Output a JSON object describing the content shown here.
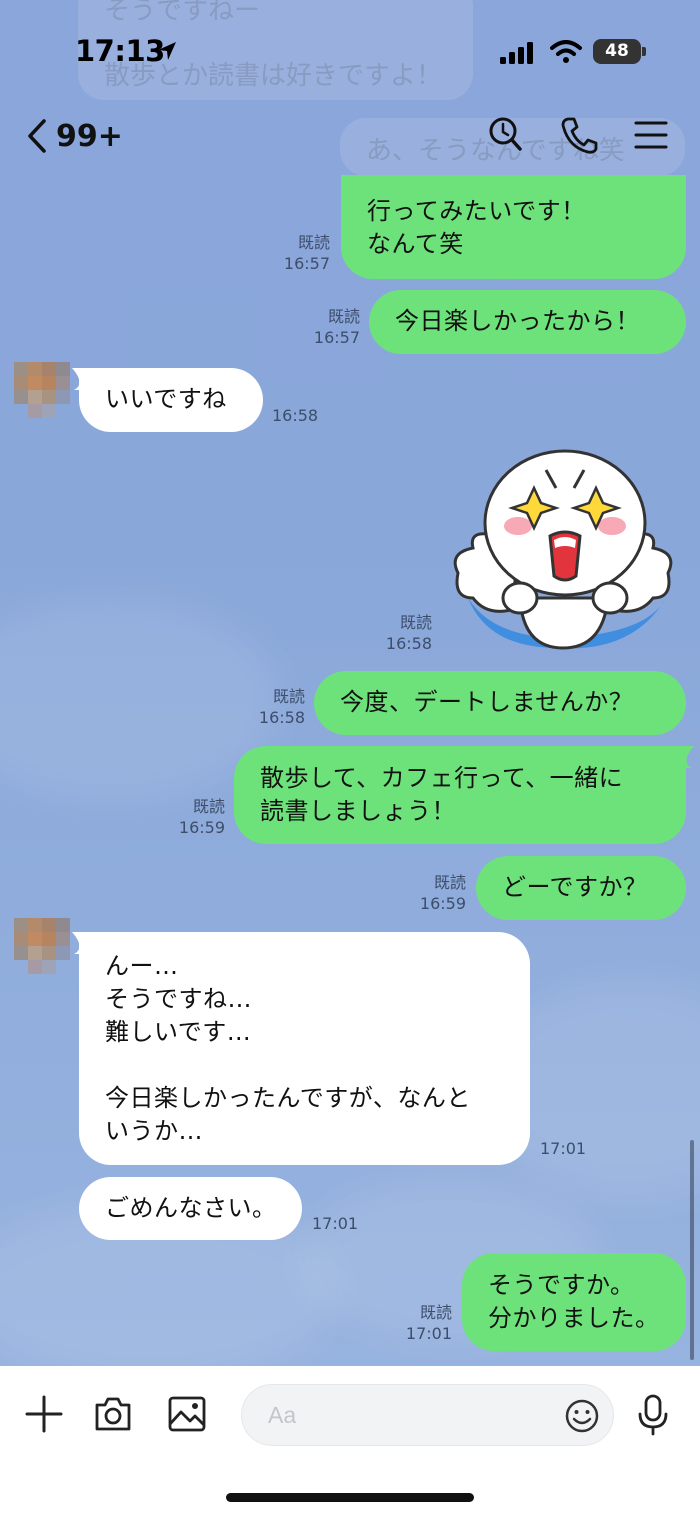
{
  "status_bar": {
    "time": "17:13",
    "battery": "48"
  },
  "header": {
    "back_count": "99+",
    "contact_name_hidden": ""
  },
  "background_preview": [
    {
      "text": "そうですねー"
    },
    {
      "text": "散歩とか読書は好きですよ！"
    },
    {
      "text": "あ、そうなんですね笑"
    }
  ],
  "messages": [
    {
      "sender": "me",
      "text": "行ってみたいです！\nなんて笑",
      "read": "既読",
      "time": "16:57"
    },
    {
      "sender": "me",
      "text": "今日楽しかったから！",
      "read": "既読",
      "time": "16:57"
    },
    {
      "sender": "them",
      "text": "いいですね",
      "time": "16:58"
    },
    {
      "sender": "me",
      "type": "sticker",
      "sticker": "excited-sparkle-eyes-sticker",
      "read": "既読",
      "time": "16:58"
    },
    {
      "sender": "me",
      "text": "今度、デートしませんか？",
      "read": "既読",
      "time": "16:58"
    },
    {
      "sender": "me",
      "text": "散歩して、カフェ行って、一緒に\n読書しましょう！",
      "read": "既読",
      "time": "16:59"
    },
    {
      "sender": "me",
      "text": "どーですか？",
      "read": "既読",
      "time": "16:59"
    },
    {
      "sender": "them",
      "text": "んー…\nそうですね…\n難しいです…\n\n今日楽しかったんですが、なんと\nいうか…",
      "time": "17:01"
    },
    {
      "sender": "them",
      "text": "ごめんなさい。",
      "time": "17:01"
    },
    {
      "sender": "me",
      "text": "そうですか。\n分かりました。",
      "read": "既読",
      "time": "17:01"
    }
  ],
  "input_bar": {
    "placeholder": "Aa"
  },
  "colors": {
    "my_bubble": "#6de27a",
    "their_bubble": "#ffffff",
    "chat_background": "#8ba6da"
  },
  "icons": [
    "location-arrow-icon",
    "cellular-signal-icon",
    "wifi-icon",
    "battery-icon",
    "back-chevron-icon",
    "search-icon",
    "phone-icon",
    "menu-icon",
    "plus-icon",
    "camera-icon",
    "image-icon",
    "emoji-icon",
    "microphone-icon"
  ]
}
